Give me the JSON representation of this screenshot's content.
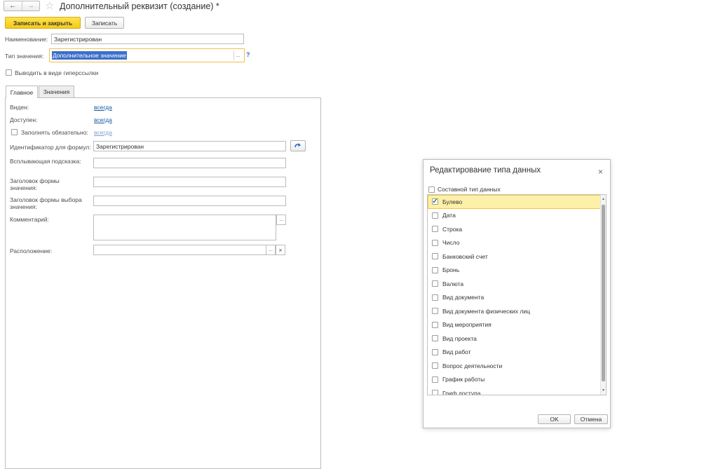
{
  "window": {
    "back_icon": "←",
    "forward_icon": "→",
    "star_icon": "☆",
    "title": "Дополнительный реквизит (создание) *"
  },
  "toolbar": {
    "save_close": "Записать и закрыть",
    "save": "Записать"
  },
  "form": {
    "name_label": "Наименование:",
    "name_value": "Зарегистрирован",
    "type_label": "Тип значения:",
    "type_value": "Дополнительное значение",
    "type_select": "...",
    "help": "?",
    "hyperlink_label": "Выводить в виде гиперссылки"
  },
  "tabs": [
    "Главное",
    "Значения"
  ],
  "main": {
    "visible_label": "Виден:",
    "visible_value": "всегда",
    "available_label": "Доступен:",
    "available_value": "всегда",
    "required_label": "Заполнять обязательно:",
    "required_value": "всегда",
    "formula_label": "Идентификатор для формул:",
    "formula_value": "Зарегистрирован",
    "tooltip_label": "Всплывающая подсказка:",
    "tooltip_value": "",
    "value_form_label": "Заголовок формы значения:",
    "value_form_value": "",
    "choice_form_label": "Заголовок формы выбора значения:",
    "choice_form_value": "",
    "comment_label": "Комментарий:",
    "comment_value": "",
    "comment_select": "...",
    "location_label": "Расположение:",
    "location_value": "",
    "location_select": "...",
    "location_clear": "×"
  },
  "dialog": {
    "title": "Редактирование типа данных",
    "close_icon": "×",
    "composite_label": "Составной тип данных",
    "items": [
      {
        "label": "Булево",
        "checked": true
      },
      {
        "label": "Дата",
        "checked": false
      },
      {
        "label": "Строка",
        "checked": false
      },
      {
        "label": "Число",
        "checked": false
      },
      {
        "label": "Банковский счет",
        "checked": false
      },
      {
        "label": "Бронь",
        "checked": false
      },
      {
        "label": "Валюта",
        "checked": false
      },
      {
        "label": "Вид документа",
        "checked": false
      },
      {
        "label": "Вид документа физических лиц",
        "checked": false
      },
      {
        "label": "Вид мероприятия",
        "checked": false
      },
      {
        "label": "Вид проекта",
        "checked": false
      },
      {
        "label": "Вид работ",
        "checked": false
      },
      {
        "label": "Вопрос деятельности",
        "checked": false
      },
      {
        "label": "График работы",
        "checked": false
      },
      {
        "label": "Гриф доступа",
        "checked": false
      }
    ],
    "ok": "OK",
    "cancel": "Отмена"
  }
}
